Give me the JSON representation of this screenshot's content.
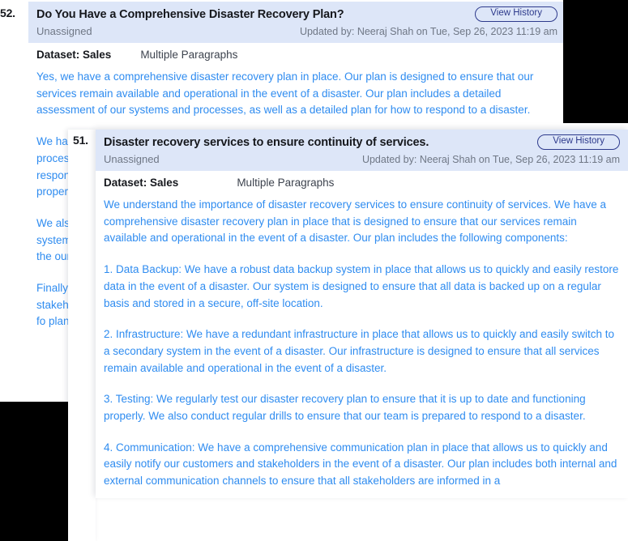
{
  "cards": [
    {
      "index": "52.",
      "title": "Do You Have a Comprehensive Disaster Recovery Plan?",
      "assignee": "Unassigned",
      "updated": "Updated by: Neeraj Shah on Tue, Sep 26, 2023 11:19 am",
      "view_history_label": "View History",
      "dataset": "Dataset: Sales",
      "answer_type": "Multiple Paragraphs",
      "paragraphs": [
        "Yes, we have a comprehensive disaster recovery plan in place. Our plan is designed to ensure that our services remain available and operational in the event of a disaster. Our plan includes a detailed assessment of our systems and processes, as well as a detailed plan for how to respond to a disaster.",
        "We ha proces respon proper",
        "We als system in the our da",
        "Finally stakeh plan fo plan in"
      ]
    },
    {
      "index": "51.",
      "title": "Disaster recovery services to ensure continuity of services.",
      "assignee": "Unassigned",
      "updated": "Updated by: Neeraj Shah on Tue, Sep 26, 2023 11:19 am",
      "view_history_label": "View History",
      "dataset": "Dataset: Sales",
      "answer_type": "Multiple Paragraphs",
      "paragraphs": [
        "We understand the importance of disaster recovery services to ensure continuity of services. We have a comprehensive disaster recovery plan in place that is designed to ensure that our services remain available and operational in the event of a disaster. Our plan includes the following components:",
        "1. Data Backup: We have a robust data backup system in place that allows us to quickly and easily restore data in the event of a disaster. Our system is designed to ensure that all data is backed up on a regular basis and stored in a secure, off-site location.",
        "2. Infrastructure: We have a redundant infrastructure in place that allows us to quickly and easily switch to a secondary system in the event of a disaster. Our infrastructure is designed to ensure that all services remain available and operational in the event of a disaster.",
        "3. Testing: We regularly test our disaster recovery plan to ensure that it is up to date and functioning properly. We also conduct regular drills to ensure that our team is prepared to respond to a disaster.",
        "4. Communication: We have a comprehensive communication plan in place that allows us to quickly and easily notify our customers and stakeholders in the event of a disaster. Our plan includes both internal and external communication channels to ensure that all stakeholders are informed in a"
      ]
    }
  ],
  "colors": {
    "header_band": "#dde6f8",
    "answer_text": "#2f8cf0",
    "button_border": "#2d3a8c",
    "muted_text": "#6f7785",
    "title_text": "#16181d"
  }
}
